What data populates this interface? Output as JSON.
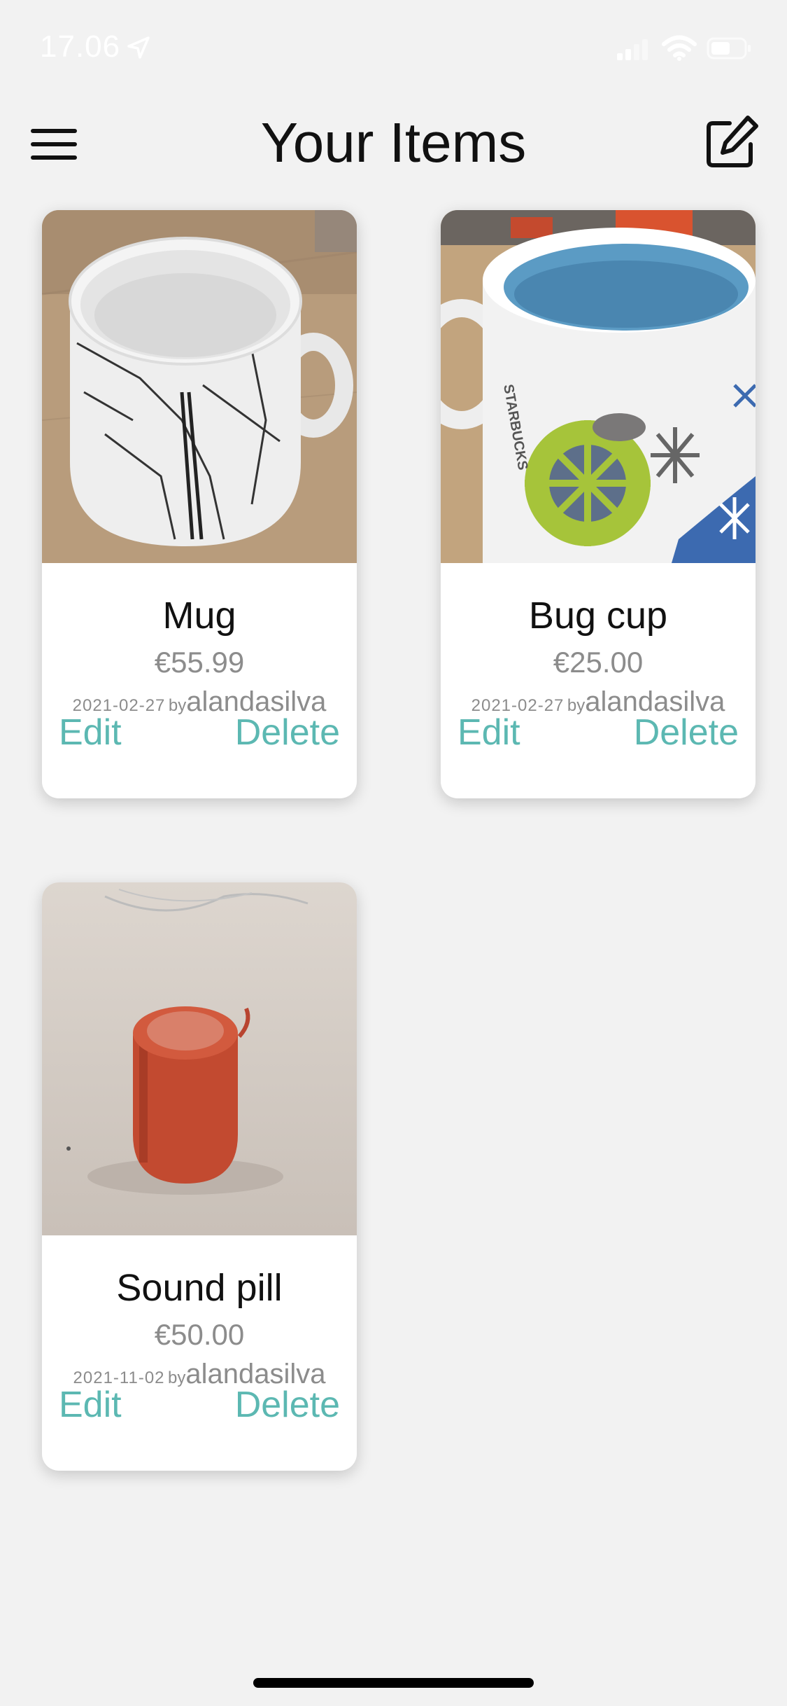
{
  "status_bar": {
    "time": "17.06",
    "icons": [
      "location-arrow-icon",
      "signal-icon",
      "wifi-icon",
      "battery-icon"
    ]
  },
  "header": {
    "title": "Your Items",
    "left_icon": "hamburger-menu-icon",
    "right_icon": "compose-icon"
  },
  "items": [
    {
      "name": "Mug",
      "price": "€55.99",
      "date": "2021-02-27",
      "by_label": "by",
      "user": "alandasilva",
      "edit_label": "Edit",
      "delete_label": "Delete",
      "photo": "white mug with black map pattern on wooden table"
    },
    {
      "name": "Bug cup",
      "price": "€25.00",
      "date": "2021-02-27",
      "by_label": "by",
      "user": "alandasilva",
      "edit_label": "Edit",
      "delete_label": "Delete",
      "photo": "white mug with blue interior and snowflake pattern"
    },
    {
      "name": "Sound pill",
      "price": "€50.00",
      "date": "2021-11-02",
      "by_label": "by",
      "user": "alandasilva",
      "edit_label": "Edit",
      "delete_label": "Delete",
      "photo": "red cylindrical bluetooth speaker"
    }
  ],
  "colors": {
    "background": "#f2f2f2",
    "accent": "#5cb8b2",
    "secondary_text": "#8c8c8c",
    "primary_text": "#111111"
  }
}
